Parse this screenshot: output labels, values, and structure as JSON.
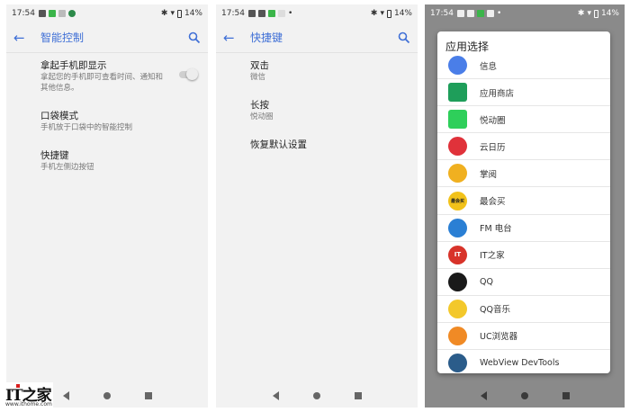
{
  "status": {
    "time": "17:54",
    "battery": "14%"
  },
  "screen1": {
    "title": "智能控制",
    "items": [
      {
        "title": "拿起手机即显示",
        "subtitle": "拿起您的手机即可查看时间、通知和",
        "subtitle2": "其他信息。"
      },
      {
        "title": "口袋模式",
        "subtitle": "手机放于口袋中的智能控制"
      },
      {
        "title": "快捷键",
        "subtitle": "手机左侧边按钮"
      }
    ]
  },
  "screen2": {
    "title": "快捷键",
    "items": [
      {
        "title": "双击",
        "subtitle": "微信"
      },
      {
        "title": "长按",
        "subtitle": "悦动圈"
      },
      {
        "title": "恢复默认设置"
      }
    ]
  },
  "screen3": {
    "dialog_title": "应用选择",
    "apps": [
      {
        "name": "信息",
        "icon": "message-icon",
        "color": "#4a7ee8"
      },
      {
        "name": "应用商店",
        "icon": "store-icon",
        "color": "#1e9e5a"
      },
      {
        "name": "悦动圈",
        "icon": "yuedongquan-icon",
        "color": "#2ecf5a"
      },
      {
        "name": "云日历",
        "icon": "calendar-icon",
        "color": "#e0323a"
      },
      {
        "name": "掌阅",
        "icon": "zhangyue-icon",
        "color": "#f0b020"
      },
      {
        "name": "最会买",
        "icon": "zuihuimai-icon",
        "color": "#f2c21a",
        "label": "最会买"
      },
      {
        "name": "FM 电台",
        "icon": "radio-icon",
        "color": "#2a7fd4"
      },
      {
        "name": "IT之家",
        "icon": "ithome-icon",
        "color": "#d8332a",
        "label": "IT"
      },
      {
        "name": "QQ",
        "icon": "qq-icon",
        "color": "#1a1a1a"
      },
      {
        "name": "QQ音乐",
        "icon": "qqmusic-icon",
        "color": "#f3c82b"
      },
      {
        "name": "UC浏览器",
        "icon": "uc-icon",
        "color": "#f08a25"
      },
      {
        "name": "WebView DevTools",
        "icon": "devtools-icon",
        "color": "#2b5c8a"
      }
    ]
  },
  "watermark": {
    "logo": "IT之家",
    "url": "www.ithome.com"
  }
}
